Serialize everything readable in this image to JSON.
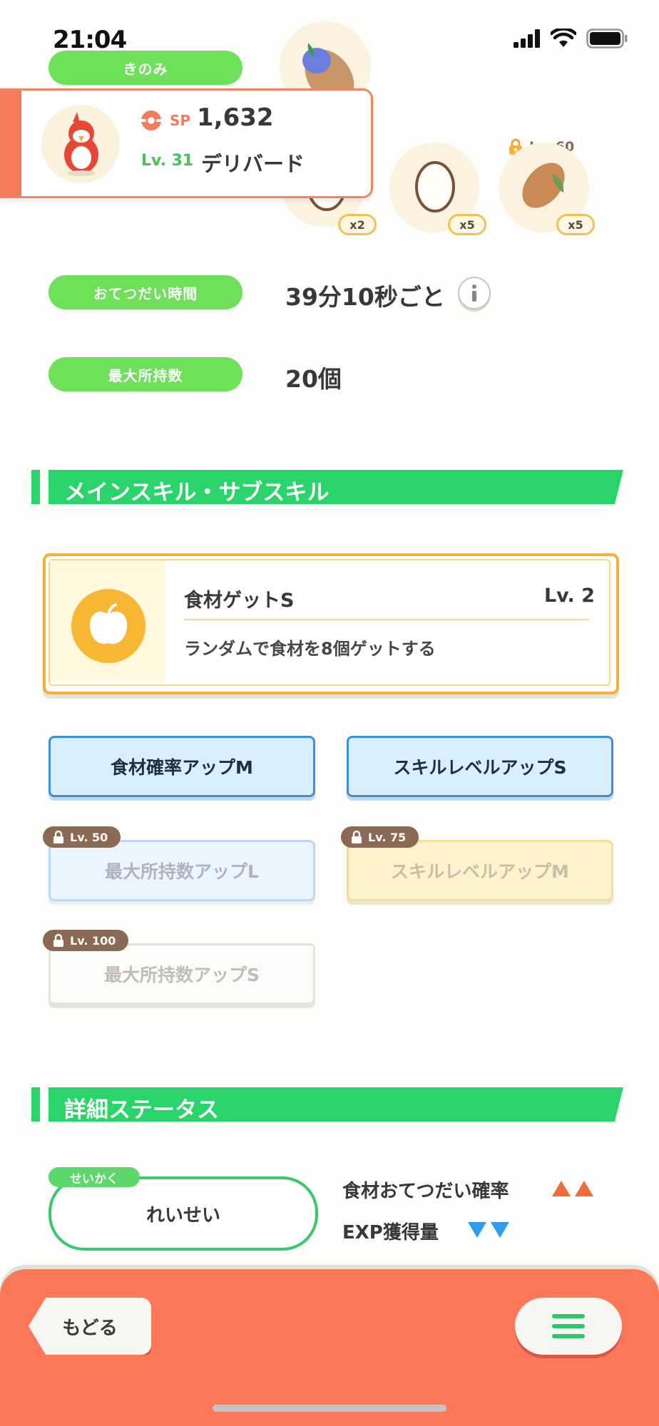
{
  "status_bar": {
    "time": "21:04"
  },
  "berry": {
    "label": "きのみ"
  },
  "ingredients": [
    {
      "qty": "x2",
      "locked": false
    },
    {
      "qty": "x5",
      "locked": false
    },
    {
      "qty": "x5",
      "locked": true,
      "lock_level": "Lv. 60"
    }
  ],
  "pokemon_card": {
    "sp_label": "SP",
    "sp_value": "1,632",
    "level": "Lv. 31",
    "name": "デリバード"
  },
  "help_time": {
    "label": "おてつだい時間",
    "value": "39分10秒ごと"
  },
  "max_carry": {
    "label": "最大所持数",
    "value": "20個"
  },
  "skills_section": {
    "title": "メインスキル・サブスキル"
  },
  "main_skill": {
    "name": "食材ゲットS",
    "level": "Lv. 2",
    "description": "ランダムで食材を8個ゲットする"
  },
  "sub_skills": [
    {
      "label": "食材確率アップM",
      "lock": ""
    },
    {
      "label": "スキルレベルアップS",
      "lock": ""
    },
    {
      "label": "最大所持数アップL",
      "lock": "Lv. 50"
    },
    {
      "label": "スキルレベルアップM",
      "lock": "Lv. 75"
    },
    {
      "label": "最大所持数アップS",
      "lock": "Lv. 100"
    }
  ],
  "details_section": {
    "title": "詳細ステータス"
  },
  "nature": {
    "tag": "せいかく",
    "value": "れいせい",
    "up_label": "食材おてつだい確率",
    "down_label": "EXP獲得量"
  },
  "bottom_bar": {
    "back_label": "もどる"
  },
  "colors": {
    "accent_green": "#2bd46a",
    "pill_green": "#6fe05a",
    "coral": "#fc7859",
    "up_arrow": "#f26b3a",
    "down_arrow": "#2e9cf2"
  }
}
